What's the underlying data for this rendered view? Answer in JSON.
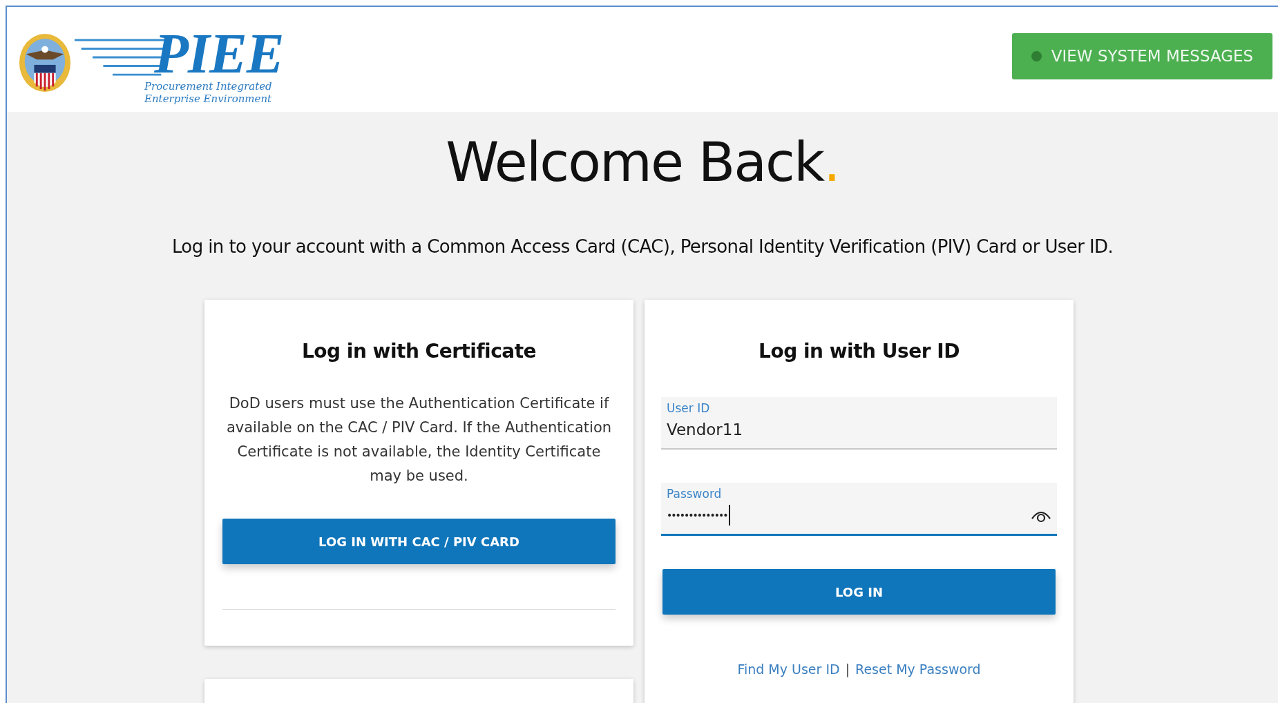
{
  "header": {
    "logo": {
      "title": "PIEE",
      "subtitle_1": "Procurement Integrated",
      "subtitle_2": "Enterprise Environment"
    },
    "messages_button": {
      "label": "VIEW SYSTEM MESSAGES"
    }
  },
  "welcome": {
    "title": "Welcome Back",
    "title_mark": ".",
    "subtitle": "Log in to your account with a Common Access Card (CAC), Personal Identity Verification (PIV) Card or User ID."
  },
  "certificate_card": {
    "title": "Log in with Certificate",
    "description": "DoD users must use the Authentication Certificate if available on the CAC / PIV Card. If the Authentication Certificate is not available, the Identity Certificate may be used.",
    "button": "LOG IN WITH CAC / PIV CARD"
  },
  "user_id_card": {
    "title": "Log in with User ID",
    "fields": [
      {
        "kind": "text",
        "label": "User ID",
        "value": "Vendor11",
        "focused": false
      },
      {
        "kind": "password",
        "label": "Password",
        "value": "••••••••••••••",
        "focused": true
      }
    ],
    "button": "LOG IN",
    "links": [
      "Find My User ID",
      "Reset My Password"
    ],
    "link_separator": "|"
  }
}
